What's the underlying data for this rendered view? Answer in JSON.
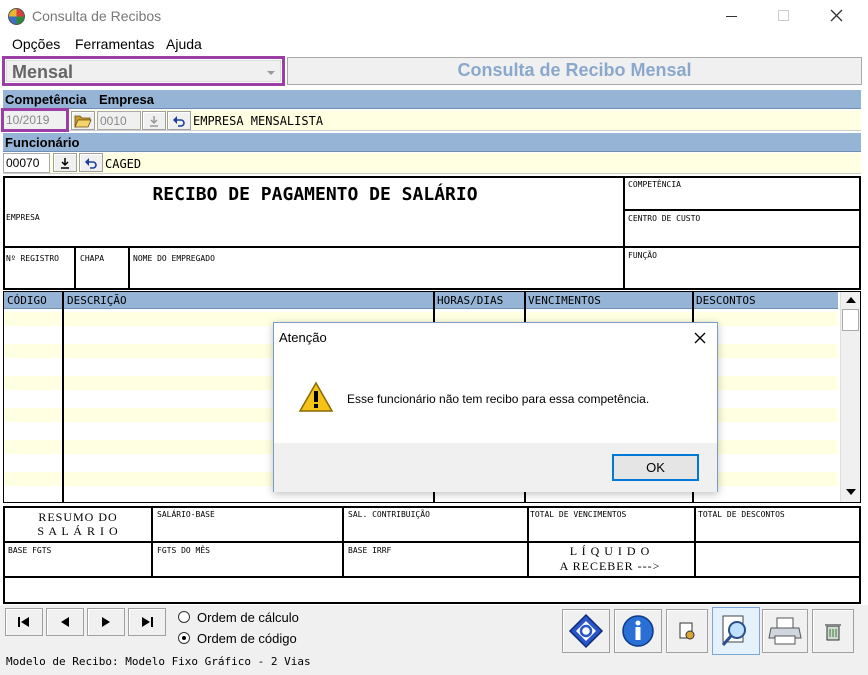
{
  "window": {
    "title": "Consulta de Recibos",
    "minimize_icon": "minimize-icon",
    "maximize_icon": "maximize-icon",
    "close_icon": "close-icon"
  },
  "menu": {
    "items": [
      "Opções",
      "Ferramentas",
      "Ajuda"
    ]
  },
  "top": {
    "period_select": "Mensal",
    "panel_title": "Consulta de Recibo Mensal"
  },
  "filters": {
    "competencia_label": "Competência",
    "empresa_label": "Empresa",
    "competencia_value": "10/2019",
    "empresa_code": "0010",
    "empresa_name": "EMPRESA MENSALISTA",
    "funcionario_label": "Funcionário",
    "funcionario_code": "00070",
    "funcionario_name": "CAGED"
  },
  "receipt": {
    "title": "RECIBO DE PAGAMENTO DE SALÁRIO",
    "competencia": "COMPETÊNCIA",
    "empresa": "EMPRESA",
    "centro_custo": "CENTRO DE CUSTO",
    "registro": "Nº REGISTRO",
    "chapa": "CHAPA",
    "nome": "NOME DO EMPREGADO",
    "funcao": "FUNÇÃO"
  },
  "grid": {
    "columns": [
      "CÓDIGO",
      "DESCRIÇÃO",
      "HORAS/DIAS",
      "VENCIMENTOS",
      "DESCONTOS"
    ]
  },
  "summary": {
    "resumo_line1": "RESUMO DO",
    "resumo_line2": "S A L Á R I O",
    "salario_base": "SALÁRIO-BASE",
    "sal_contribuicao": "SAL. CONTRIBUIÇÃO",
    "total_vencimentos": "TOTAL DE VENCIMENTOS",
    "total_descontos": "TOTAL DE DESCONTOS",
    "base_fgts": "BASE FGTS",
    "fgts_mes": "FGTS DO MÊS",
    "base_irrf": "BASE IRRF",
    "liquido_line1": "L Í Q U I D O",
    "liquido_line2": "A RECEBER --->"
  },
  "order": {
    "option1": "Ordem de cálculo",
    "option2": "Ordem de código",
    "selected": "Ordem de código"
  },
  "status": {
    "text": "Modelo de Recibo: Modelo Fixo Gráfico - 2 Vias"
  },
  "dialog": {
    "title": "Atenção",
    "message": "Esse funcionário não tem recibo para essa competência.",
    "ok_label": "OK",
    "icon": "warning-icon"
  },
  "colors": {
    "header_blue": "#95b4d6",
    "highlight_purple": "#9b3fa6",
    "row_yellow": "#ffffe1",
    "panel_title_color": "#8aa8cc"
  }
}
